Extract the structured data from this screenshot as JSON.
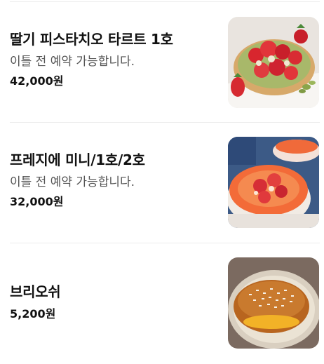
{
  "menu": {
    "items": [
      {
        "name": "딸기 피스타치오 타르트 1호",
        "description": "이틀 전 예약 가능합니다.",
        "price": "42,000원",
        "image": "strawberry-pistachio-tart-photo"
      },
      {
        "name": "프레지에 미니/1호/2호",
        "description": "이틀 전 예약 가능합니다.",
        "price": "32,000원",
        "image": "fraisier-cake-photo"
      },
      {
        "name": "브리오쉬",
        "price": "5,200원",
        "image": "brioche-photo"
      }
    ]
  }
}
